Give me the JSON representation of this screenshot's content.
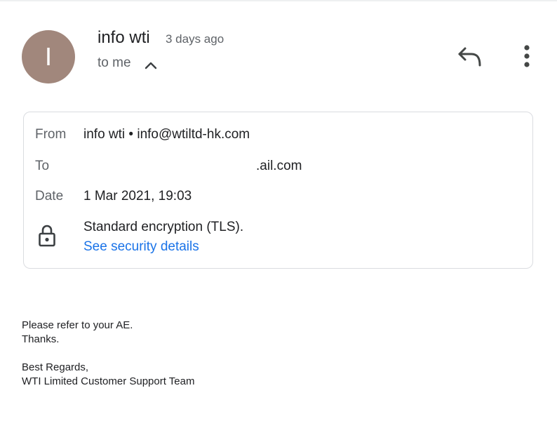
{
  "header": {
    "avatar_letter": "I",
    "sender_name": "info wti",
    "time_ago": "3 days ago",
    "recipient_summary": "to me"
  },
  "details": {
    "from_label": "From",
    "from_value": "info wti • info@wtiltd-hk.com",
    "to_label": "To",
    "to_value": ".ail.com",
    "date_label": "Date",
    "date_value": "1 Mar 2021, 19:03",
    "encryption_text": "Standard encryption (TLS).",
    "security_link": "See security details"
  },
  "body": {
    "line1": "Please refer to your AE.",
    "line2": "Thanks.",
    "line3": "Best Regards,",
    "line4": "WTI Limited Customer Support Team"
  },
  "icons": {
    "reply": "reply-icon",
    "more": "more-vert-icon",
    "expand": "chevron-up-icon",
    "lock": "lock-icon"
  },
  "colors": {
    "avatar_bg": "#a1877c",
    "link": "#1a73e8",
    "secondary_text": "#5f6368"
  }
}
